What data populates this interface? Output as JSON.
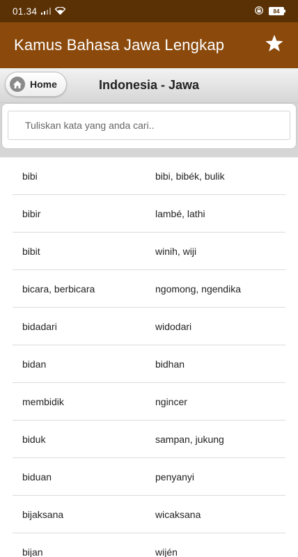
{
  "status_bar": {
    "time": "01.34",
    "battery": "84"
  },
  "app_bar": {
    "title": "Kamus Bahasa Jawa Lengkap"
  },
  "sub_header": {
    "home_label": "Home",
    "title": "Indonesia - Jawa"
  },
  "search": {
    "placeholder": "Tuliskan kata yang anda cari.."
  },
  "entries": [
    {
      "word": "bibi",
      "translation": "bibi, bibék, bulik"
    },
    {
      "word": "bibir",
      "translation": "lambé, lathi"
    },
    {
      "word": "bibit",
      "translation": "winih, wiji"
    },
    {
      "word": "bicara, berbicara",
      "translation": "ngomong, ngendika"
    },
    {
      "word": "bidadari",
      "translation": "widodari"
    },
    {
      "word": "bidan",
      "translation": "bidhan"
    },
    {
      "word": "membidik",
      "translation": "ngincer"
    },
    {
      "word": "biduk",
      "translation": "sampan, jukung"
    },
    {
      "word": "biduan",
      "translation": "penyanyi"
    },
    {
      "word": "bijaksana",
      "translation": "wicaksana"
    },
    {
      "word": "bijan",
      "translation": "wijén"
    }
  ]
}
